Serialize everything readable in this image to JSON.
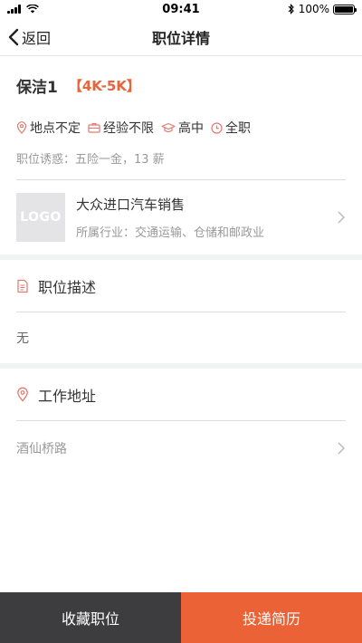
{
  "status": {
    "time": "09:41",
    "battery": "100%",
    "battery_level": 1.0
  },
  "nav": {
    "back_label": "返回",
    "title": "职位详情"
  },
  "job": {
    "title": "保洁1",
    "salary": "【4K-5K】",
    "tags": [
      {
        "icon": "location-pin-icon",
        "label": "地点不定"
      },
      {
        "icon": "briefcase-icon",
        "label": "经验不限"
      },
      {
        "icon": "graduation-cap-icon",
        "label": "高中"
      },
      {
        "icon": "clock-icon",
        "label": "全职"
      }
    ],
    "perk": "职位诱惑：五险一金，13 薪"
  },
  "company": {
    "logo_text": "LOGO",
    "name": "大众进口汽车销售",
    "industry": "所属行业：交通运输、仓储和邮政业"
  },
  "description": {
    "title": "职位描述",
    "content": "无"
  },
  "address": {
    "title": "工作地址",
    "value": "酒仙桥路"
  },
  "actions": {
    "favorite": "收藏职位",
    "apply": "投递简历"
  },
  "colors": {
    "accent": "#ea6236",
    "dark": "#3d3d3f",
    "icon": "#e07a6e"
  }
}
